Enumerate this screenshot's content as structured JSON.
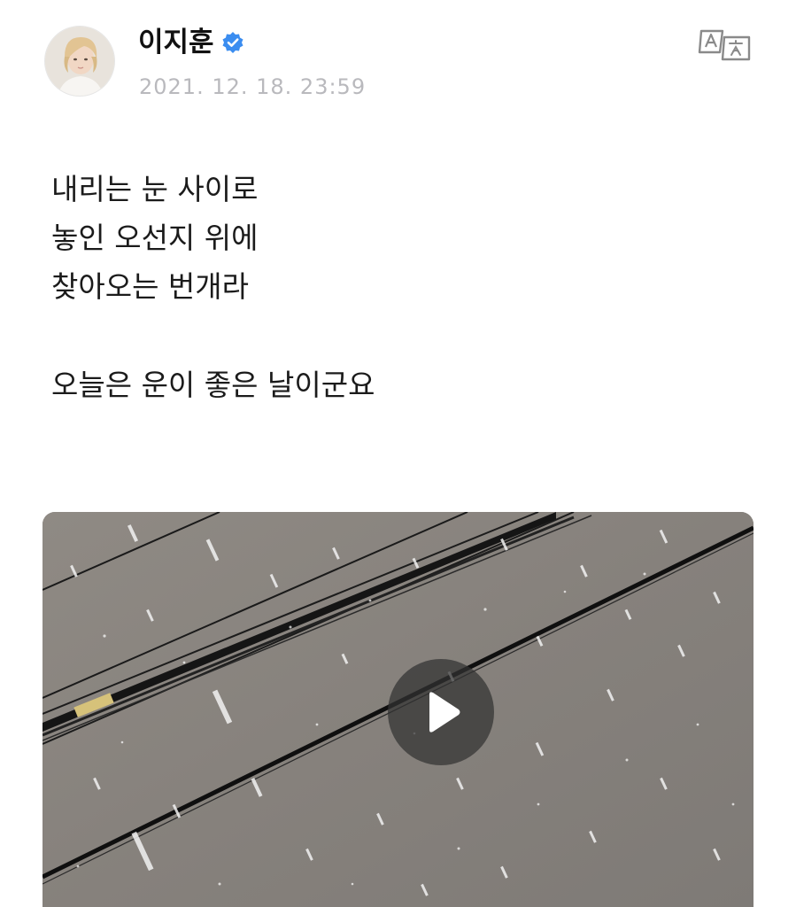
{
  "post": {
    "author_name": "이지훈",
    "timestamp": "2021. 12. 18. 23:59",
    "lines": [
      "내리는 눈 사이로",
      "놓인 오선지 위에",
      "찾아오는 번개라",
      "",
      "오늘은 운이 좋은 날이군요"
    ]
  },
  "icons": {
    "verified": "verified-badge-icon",
    "translate": "translate-icon",
    "play": "play-icon"
  },
  "colors": {
    "verified_badge": "#3b8df0",
    "timestamp": "#b9b9bd",
    "text": "#1b1b1b",
    "icon_gray": "#8a8a8a"
  }
}
